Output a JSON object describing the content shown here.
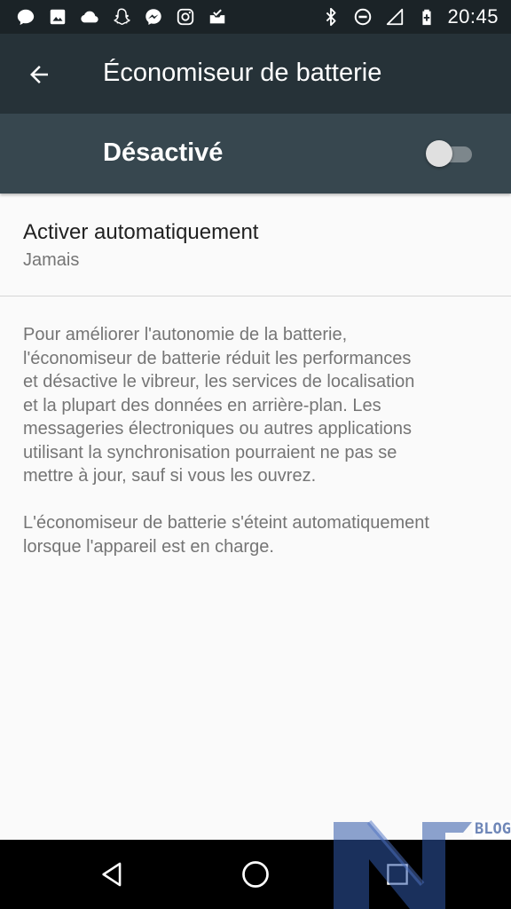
{
  "status_bar": {
    "left_icons": [
      "chat-bubble-icon",
      "image-icon",
      "cloud-icon",
      "snapchat-ghost-icon",
      "messenger-icon",
      "instagram-icon",
      "inbox-check-icon"
    ],
    "right_icons": [
      "bluetooth-icon",
      "do-not-disturb-icon",
      "signal-icon",
      "battery-saver-icon"
    ],
    "time": "20:45"
  },
  "app_bar": {
    "back_icon": "arrow-back-icon",
    "title": "Économiseur de batterie"
  },
  "switch_bar": {
    "label": "Désactivé",
    "enabled": false
  },
  "preference": {
    "title": "Activer automatiquement",
    "summary": "Jamais"
  },
  "description": {
    "paragraph1_lines": [
      "Pour améliorer l'autonomie de la batterie,",
      "l'économiseur de batterie réduit les performances",
      "et désactive le vibreur, les services de localisation",
      "et la plupart des données en arrière-plan. Les",
      "messageries électroniques ou autres applications",
      "utilisant la synchronisation pourraient ne pas se",
      "mettre à jour, sauf si vous les ouvrez."
    ],
    "paragraph2_lines": [
      "L'économiseur de batterie s'éteint automatiquement",
      "lorsque l'appareil est en charge."
    ]
  },
  "nav_bar": {
    "icons": [
      "back-triangle-icon",
      "home-circle-icon",
      "recents-square-icon"
    ]
  },
  "watermark": {
    "text": "BLOG"
  },
  "colors": {
    "status_bar": "#1b2327",
    "app_bar": "#263238",
    "switch_bar": "#37474f",
    "background": "#fafafa"
  }
}
